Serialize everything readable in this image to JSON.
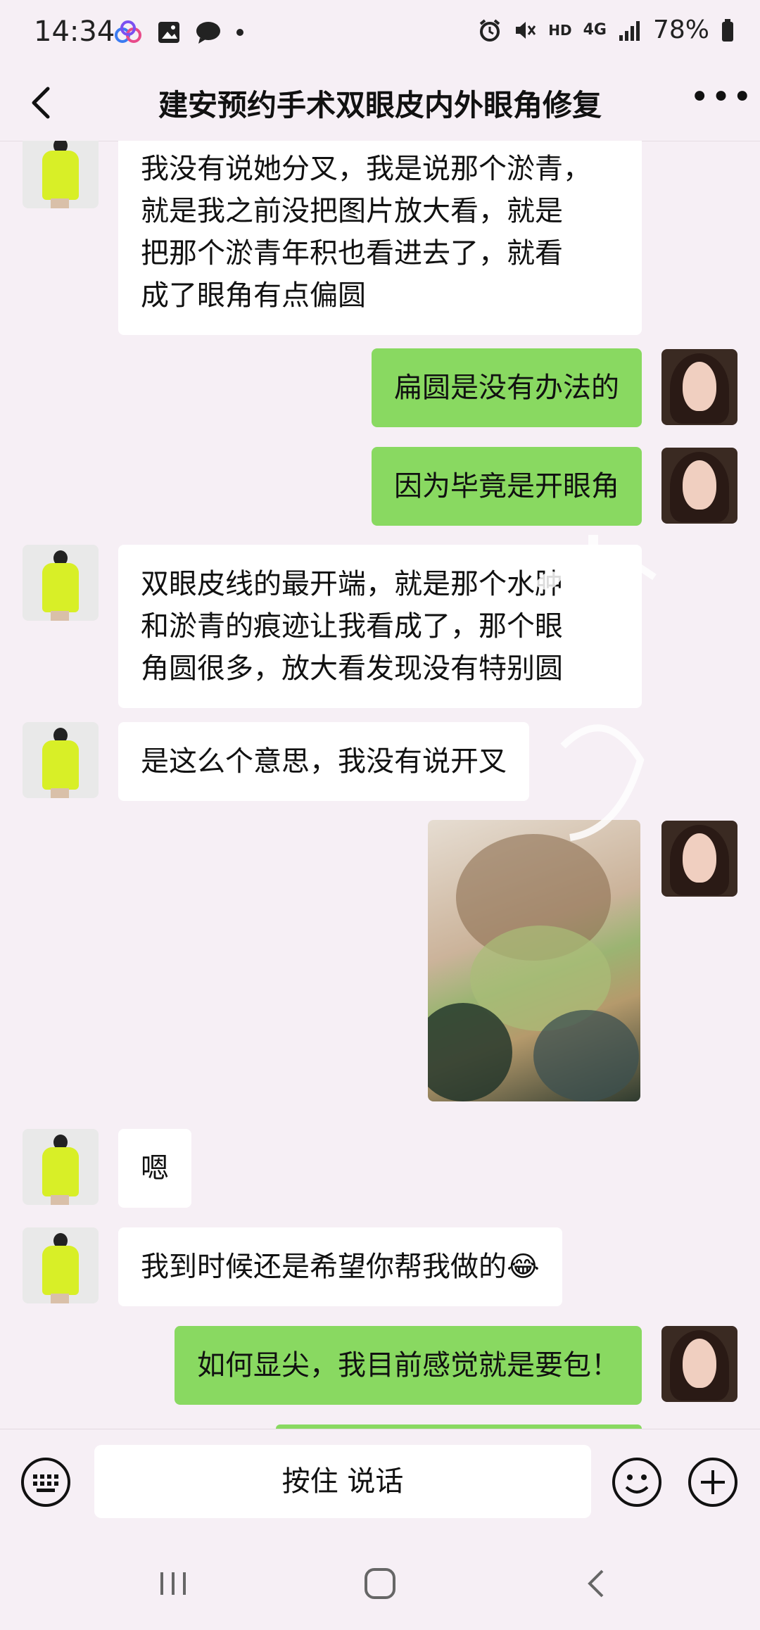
{
  "status_bar": {
    "time": "14:34",
    "battery": "78%",
    "icons": [
      "cloud-icon",
      "image-icon",
      "chat-icon",
      "dot-icon",
      "alarm-icon",
      "mute-icon",
      "hd-icon",
      "4g-icon",
      "signal-icon",
      "battery-icon"
    ],
    "network_hd": "HD",
    "network_4g": "4G"
  },
  "header": {
    "title": "建安预约手术双眼皮内外眼角修复",
    "more_label": "•••"
  },
  "messages": [
    {
      "side": "left",
      "text": "我没有说她分叉，我是说那个淤青，\n就是我之前没把图片放大看，就是\n把那个淤青年积也看进去了，就看\n成了眼角有点偏圆"
    },
    {
      "side": "right",
      "text": "扁圆是没有办法的"
    },
    {
      "side": "right",
      "text": "因为毕竟是开眼角"
    },
    {
      "side": "left",
      "text": "双眼皮线的最开端，就是那个水肿\n和淤青的痕迹让我看成了，那个眼\n角圆很多，放大看发现没有特别圆"
    },
    {
      "side": "left",
      "text": "是这么个意思，我没有说开叉"
    },
    {
      "side": "right",
      "type": "image"
    },
    {
      "side": "left",
      "text": "嗯"
    },
    {
      "side": "left",
      "text": "我到时候还是希望你帮我做的😂"
    },
    {
      "side": "right",
      "text": "如何显尖，我目前感觉就是要包！"
    }
  ],
  "watermark": {
    "text": "XIAOMAN"
  },
  "input_bar": {
    "voice_label": "按住 说话"
  },
  "colors": {
    "background": "#f6eff5",
    "right_bubble": "#89d961",
    "left_bubble": "#ffffff"
  }
}
